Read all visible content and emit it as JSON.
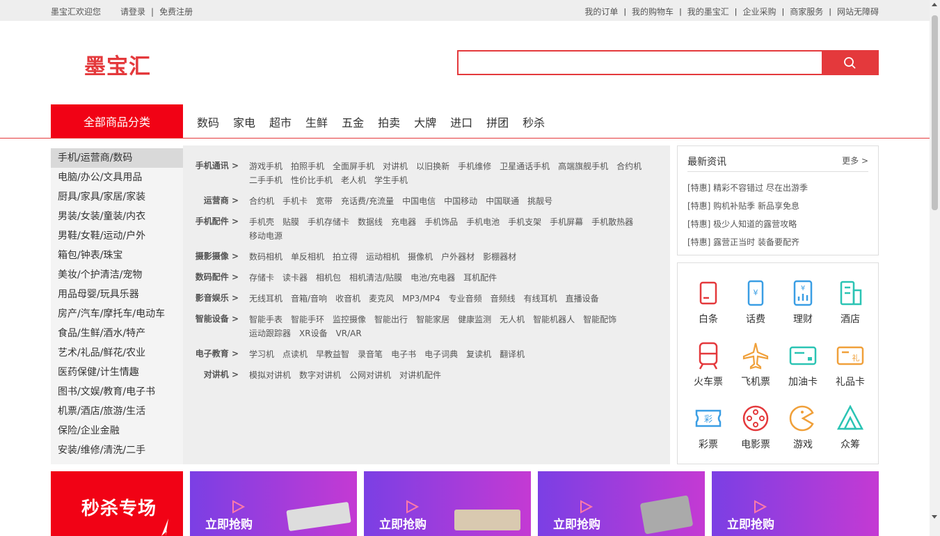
{
  "topbar": {
    "welcome": "墨宝汇欢迎您",
    "login": "请登录",
    "register": "免费注册",
    "links": [
      "我的订单",
      "我的购物车",
      "我的墨宝汇",
      "企业采购",
      "商家服务",
      "网站无障碍"
    ]
  },
  "logo": "墨宝汇",
  "search": {
    "placeholder": ""
  },
  "nav": {
    "all_label": "全部商品分类",
    "items": [
      "数码",
      "家电",
      "超市",
      "生鲜",
      "五金",
      "拍卖",
      "大牌",
      "进口",
      "拼团",
      "秒杀"
    ]
  },
  "sidebar": [
    "手机/运营商/数码",
    "电脑/办公/文具用品",
    "厨具/家具/家居/家装",
    "男装/女装/童装/内衣",
    "男鞋/女鞋/运动/户外",
    "箱包/钟表/珠宝",
    "美妆/个护清洁/宠物",
    "用品母婴/玩具乐器",
    "房产/汽车/摩托车/电动车",
    "食品/生鲜/酒水/特产",
    "艺术/礼品/鲜花/农业",
    "医药保健/计生情趣",
    "图书/文娱/教育/电子书",
    "机票/酒店/旅游/生活",
    "保险/企业金融",
    "安装/维修/清洗/二手"
  ],
  "submenu": [
    {
      "title": "手机通讯 >",
      "items": [
        "游戏手机",
        "拍照手机",
        "全面屏手机",
        "对讲机",
        "以旧换新",
        "手机维修",
        "卫星通话手机",
        "高端旗舰手机",
        "合约机",
        "二手手机",
        "性价比手机",
        "老人机",
        "学生手机"
      ]
    },
    {
      "title": "运营商 >",
      "items": [
        "合约机",
        "手机卡",
        "宽带",
        "充话费/充流量",
        "中国电信",
        "中国移动",
        "中国联通",
        "挑靓号"
      ]
    },
    {
      "title": "手机配件 >",
      "items": [
        "手机壳",
        "贴膜",
        "手机存储卡",
        "数据线",
        "充电器",
        "手机饰品",
        "手机电池",
        "手机支架",
        "手机屏幕",
        "手机散热器",
        "移动电源"
      ]
    },
    {
      "title": "摄影摄像 >",
      "items": [
        "数码相机",
        "单反相机",
        "拍立得",
        "运动相机",
        "摄像机",
        "户外器材",
        "影棚器材"
      ]
    },
    {
      "title": "数码配件 >",
      "items": [
        "存储卡",
        "读卡器",
        "相机包",
        "相机清洁/贴膜",
        "电池/充电器",
        "耳机配件"
      ]
    },
    {
      "title": "影音娱乐 >",
      "items": [
        "无线耳机",
        "音箱/音响",
        "收音机",
        "麦克风",
        "MP3/MP4",
        "专业音频",
        "音频线",
        "有线耳机",
        "直播设备"
      ]
    },
    {
      "title": "智能设备 >",
      "items": [
        "智能手表",
        "智能手环",
        "监控摄像",
        "智能出行",
        "智能家居",
        "健康监测",
        "无人机",
        "智能机器人",
        "智能配饰",
        "运动跟踪器",
        "XR设备",
        "VR/AR"
      ]
    },
    {
      "title": "电子教育 >",
      "items": [
        "学习机",
        "点读机",
        "早教益智",
        "录音笔",
        "电子书",
        "电子词典",
        "复读机",
        "翻译机"
      ]
    },
    {
      "title": "对讲机 >",
      "items": [
        "模拟对讲机",
        "数字对讲机",
        "公网对讲机",
        "对讲机配件"
      ]
    }
  ],
  "news": {
    "title": "最新资讯",
    "more": "更多 >",
    "items": [
      "[特惠] 精彩不容错过 尽在出游季",
      "[特惠] 购机补贴季 新品享免息",
      "[特惠] 极少人知道的露营攻略",
      "[特惠] 露营正当时 装备要配齐"
    ]
  },
  "services": [
    {
      "label": "白条",
      "icon": "iou-icon",
      "color": "#e4393c"
    },
    {
      "label": "话费",
      "icon": "phone-bill-icon",
      "color": "#3a9ee4"
    },
    {
      "label": "理财",
      "icon": "finance-icon",
      "color": "#3a9ee4"
    },
    {
      "label": "酒店",
      "icon": "hotel-icon",
      "color": "#2bc4b4"
    },
    {
      "label": "火车票",
      "icon": "train-icon",
      "color": "#e4393c"
    },
    {
      "label": "飞机票",
      "icon": "plane-icon",
      "color": "#f0a03a"
    },
    {
      "label": "加油卡",
      "icon": "fuel-card-icon",
      "color": "#2bc4b4"
    },
    {
      "label": "礼品卡",
      "icon": "gift-card-icon",
      "color": "#f0a03a"
    },
    {
      "label": "彩票",
      "icon": "lottery-icon",
      "color": "#3a9ee4"
    },
    {
      "label": "电影票",
      "icon": "movie-icon",
      "color": "#e4393c"
    },
    {
      "label": "游戏",
      "icon": "game-icon",
      "color": "#f0a03a"
    },
    {
      "label": "众筹",
      "icon": "crowdfunding-icon",
      "color": "#2bc4b4"
    }
  ],
  "flash_sale": {
    "title": "秒杀专场"
  },
  "promos": [
    "立即抢购",
    "立即抢购",
    "立即抢购",
    "立即抢购"
  ],
  "colors": {
    "brand": "#e4393c",
    "nav_red": "#f10215"
  }
}
